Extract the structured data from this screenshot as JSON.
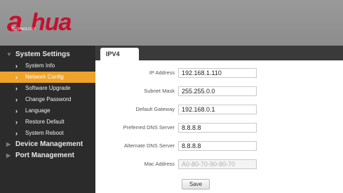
{
  "header": {
    "logo_mark": "a",
    "logo_word": "hua",
    "logo_tag": "TECHNOLOGY"
  },
  "sidebar": {
    "system_settings": "System Settings",
    "items": [
      {
        "label": "System Info",
        "active": false
      },
      {
        "label": "Network Config",
        "active": true
      },
      {
        "label": "Software Upgrade",
        "active": false
      },
      {
        "label": "Change Password",
        "active": false
      },
      {
        "label": "Language",
        "active": false
      },
      {
        "label": "Restore Default",
        "active": false
      },
      {
        "label": "System Reboot",
        "active": false
      }
    ],
    "device_management": "Device Management",
    "port_management": "Port Management"
  },
  "tabs": {
    "ipv4": "IPV4"
  },
  "form": {
    "ip_address": {
      "label": "IP Address",
      "value": "192.168.1.110"
    },
    "subnet_mask": {
      "label": "Subnet Mask",
      "value": "255.255.0.0"
    },
    "default_gateway": {
      "label": "Default Gateway",
      "value": "192.168.0.1"
    },
    "preferred_dns": {
      "label": "Preferred DNS Server",
      "value": "8.8.8.8"
    },
    "alternate_dns": {
      "label": "Alternate DNS Server",
      "value": "8.8.8.8"
    },
    "mac_address": {
      "label": "Mac Address",
      "value": "A0-80-70-90-80-70"
    },
    "save_label": "Save"
  },
  "colors": {
    "brand_red": "#c8102e",
    "active_item": "#f0a32a",
    "sidebar_bg": "#2b2b2b",
    "header_bg": "#8c8c8c"
  }
}
